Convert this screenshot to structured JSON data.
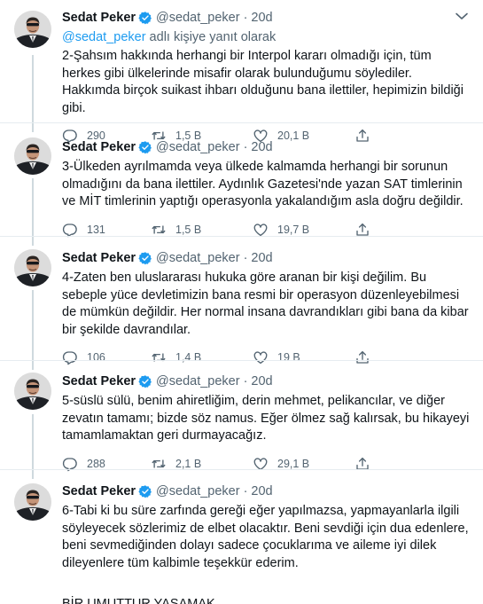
{
  "tweets": [
    {
      "name": "Sedat Peker",
      "handle": "@sedat_peker",
      "time": "20d",
      "replying_prefix": "",
      "replying_mention": "@sedat_peker",
      "replying_suffix": " adlı kişiye yanıt olarak",
      "text": "2-Şahsım hakkında herhangi bir Interpol kararı olmadığı için, tüm herkes gibi ülkelerinde misafir olarak bulunduğumu söylediler. Hakkımda birçok suikast ihbarı olduğunu bana ilettiler, hepimizin bildiği gibi.",
      "replies": "290",
      "retweets": "1,5 B",
      "likes": "20,1 B"
    },
    {
      "name": "Sedat Peker",
      "handle": "@sedat_peker",
      "time": "20d",
      "text": "3-Ülkeden ayrılmamda veya ülkede kalmamda herhangi bir sorunun olmadığını da bana ilettiler. Aydınlık Gazetesi'nde yazan SAT timlerinin ve MİT timlerinin yaptığı operasyonla yakalandığım asla doğru değildir.",
      "replies": "131",
      "retweets": "1,5 B",
      "likes": "19,7 B"
    },
    {
      "name": "Sedat Peker",
      "handle": "@sedat_peker",
      "time": "20d",
      "text": "4-Zaten ben uluslararası hukuka göre aranan bir kişi değilim. Bu sebeple yüce devletimizin bana resmi bir operasyon düzenleyebilmesi de mümkün değildir. Her normal insana davrandıkları gibi bana da kibar bir şekilde davrandılar.",
      "replies": "106",
      "retweets": "1,4 B",
      "likes": "19 B"
    },
    {
      "name": "Sedat Peker",
      "handle": "@sedat_peker",
      "time": "20d",
      "text": "5-süslü sülü, benim ahiretliğim, derin mehmet, pelikancılar, ve diğer zevatın tamamı; bizde söz namus. Eğer ölmez sağ kalırsak, bu hikayeyi tamamlamaktan geri durmayacağız.",
      "replies": "288",
      "retweets": "2,1 B",
      "likes": "29,1 B"
    },
    {
      "name": "Sedat Peker",
      "handle": "@sedat_peker",
      "time": "20d",
      "text": "6-Tabi ki bu süre zarfında gereği eğer yapılmazsa, yapmayanlarla ilgili söyleyecek sözlerimiz de elbet olacaktır. Beni sevdiği için dua edenlere, beni sevmediğinden dolayı sadece çocuklarıma ve aileme iyi dilek dileyenlere tüm kalbimle teşekkür ederim.",
      "signature": "BİR UMUTTUR YAŞAMAK"
    }
  ],
  "icons": {
    "verified": "verified-badge-icon",
    "more": "more-options-icon",
    "reply": "reply-icon",
    "retweet": "retweet-icon",
    "like": "heart-icon",
    "share": "share-icon"
  },
  "colors": {
    "accent": "#1d9bf0",
    "muted": "#536471",
    "text": "#0f1419",
    "divider": "#e6ecf0"
  }
}
